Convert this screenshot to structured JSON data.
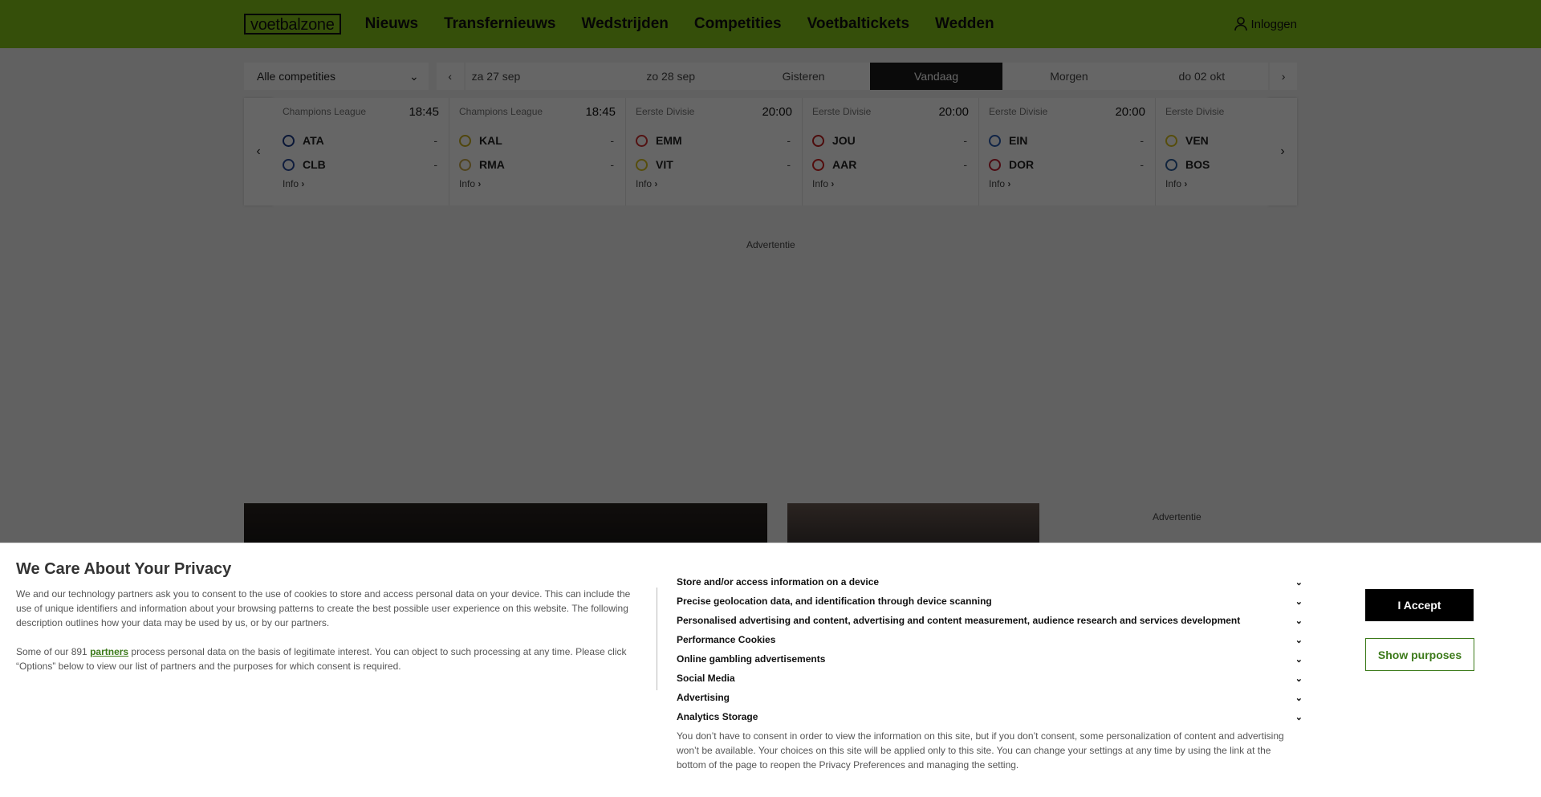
{
  "header": {
    "logo": "voetbalzone",
    "nav": [
      "Nieuws",
      "Transfernieuws",
      "Wedstrijden",
      "Competities",
      "Voetbaltickets",
      "Wedden"
    ],
    "login": "Inloggen",
    "bg_color": "#85c61a"
  },
  "filter": {
    "competition": "Alle competities",
    "dates": [
      "za 27 sep",
      "zo 28 sep",
      "Gisteren",
      "Vandaag",
      "Morgen",
      "do 02 okt"
    ],
    "active_date": "Vandaag"
  },
  "matches": [
    {
      "competition": "Champions League",
      "time": "18:45",
      "home": "ATA",
      "away": "CLB",
      "home_score": "-",
      "away_score": "-",
      "info": "Info"
    },
    {
      "competition": "Champions League",
      "time": "18:45",
      "home": "KAL",
      "away": "RMA",
      "home_score": "-",
      "away_score": "-",
      "info": "Info"
    },
    {
      "competition": "Eerste Divisie",
      "time": "20:00",
      "home": "EMM",
      "away": "VIT",
      "home_score": "-",
      "away_score": "-",
      "info": "Info"
    },
    {
      "competition": "Eerste Divisie",
      "time": "20:00",
      "home": "JOU",
      "away": "AAR",
      "home_score": "-",
      "away_score": "-",
      "info": "Info"
    },
    {
      "competition": "Eerste Divisie",
      "time": "20:00",
      "home": "EIN",
      "away": "DOR",
      "home_score": "-",
      "away_score": "-",
      "info": "Info"
    },
    {
      "competition": "Eerste Divisie",
      "time": "",
      "home": "VEN",
      "away": "BOS",
      "home_score": "",
      "away_score": "",
      "info": "Info"
    }
  ],
  "ads": {
    "label_top": "Advertentie",
    "label_side": "Advertentie"
  },
  "consent": {
    "title": "We Care About Your Privacy",
    "para1": "We and our technology partners ask you to consent to the use of cookies to store and access personal data on your device. This can include the use of unique identifiers and information about your browsing patterns to create the best possible user experience on this website. The following description outlines how your data may be used by us, or by our partners.",
    "para2_before": "Some of our 891 ",
    "para2_link": "partners",
    "para2_after": " process personal data on the basis of legitimate interest. You can object to such processing at any time. Please click “Options” below to view our list of partners and the purposes for which consent is required.",
    "purposes": [
      "Store and/or access information on a device",
      "Precise geolocation data, and identification through device scanning",
      "Personalised advertising and content, advertising and content measurement, audience research and services development",
      "Performance Cookies",
      "Online gambling advertisements",
      "Social Media",
      "Advertising",
      "Analytics Storage"
    ],
    "note": "You don’t have to consent in order to view the information on this site, but if you don’t consent, some personalization of content and advertising won’t be available. Your choices on this site will be applied only to this site. You can change your settings at any time by using the link at the bottom of the page to reopen the Privacy Preferences and managing the setting.",
    "accept_label": "I Accept",
    "purposes_label": "Show purposes",
    "accent_color": "#3c7a1a"
  }
}
